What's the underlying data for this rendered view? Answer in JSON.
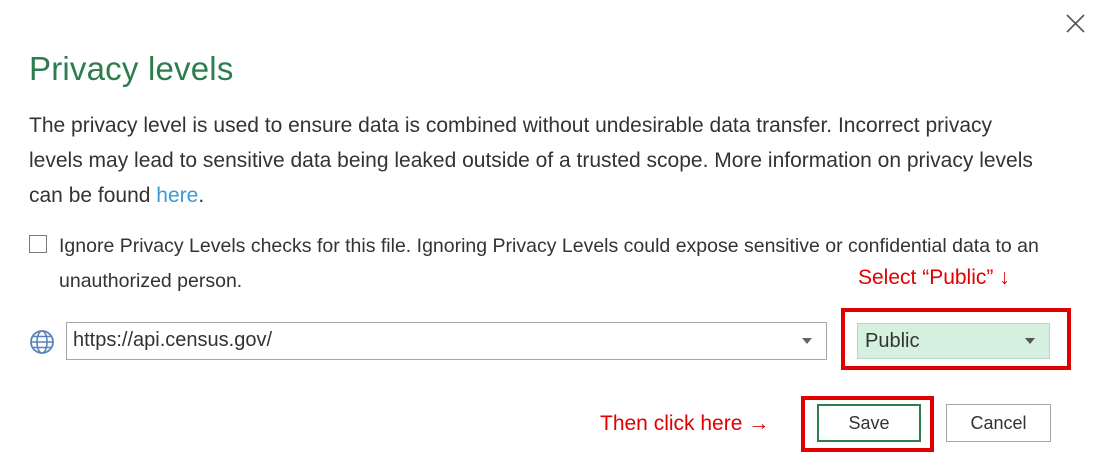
{
  "dialog": {
    "title": "Privacy levels",
    "description_pre": "The privacy level is used to ensure data is combined without undesirable data transfer. Incorrect privacy levels may lead to sensitive data being leaked outside of a trusted scope. More information on privacy levels can be found ",
    "description_link": "here",
    "description_post": ".",
    "close_icon": "close-icon"
  },
  "ignore_option": {
    "checked": false,
    "label": "Ignore Privacy Levels checks for this file. Ignoring Privacy Levels could expose sensitive or confidential data to an unauthorized person."
  },
  "source": {
    "icon": "globe-icon",
    "url": "https://api.census.gov/",
    "privacy_level": "Public"
  },
  "buttons": {
    "save": "Save",
    "cancel": "Cancel"
  },
  "annotations": {
    "select_hint": "Select “Public” ↓",
    "click_hint": "Then click here →",
    "color": "#e00000"
  },
  "colors": {
    "title": "#2e7d4f",
    "link": "#3a9ad9",
    "selected_bg": "#d6f0e0"
  }
}
